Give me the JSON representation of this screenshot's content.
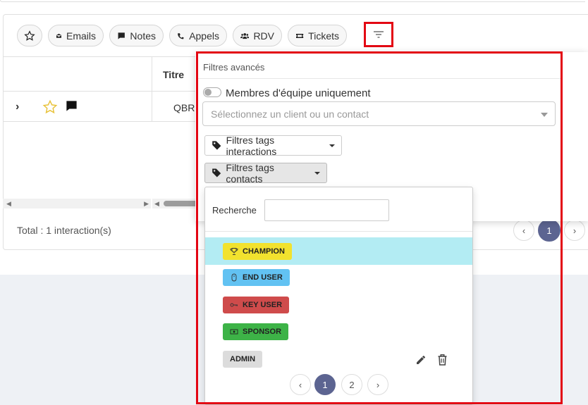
{
  "toolbar": {
    "items": [
      {
        "label": "",
        "icon": "star-icon"
      },
      {
        "label": "Emails",
        "icon": "envelope-icon"
      },
      {
        "label": "Notes",
        "icon": "comment-icon"
      },
      {
        "label": "Appels",
        "icon": "phone-icon"
      },
      {
        "label": "RDV",
        "icon": "users-icon"
      },
      {
        "label": "Tickets",
        "icon": "ticket-icon"
      }
    ],
    "filter_icon": "filter-lines-icon"
  },
  "table": {
    "columns": [
      "",
      "Titre"
    ],
    "rows": [
      {
        "title": "QBR"
      }
    ]
  },
  "footer": {
    "total": "Total : 1 interaction(s)",
    "pages": [
      "‹",
      "1",
      "›"
    ],
    "active_page": "1"
  },
  "advanced_filters": {
    "header": "Filtres avancés",
    "team_toggle_label": "Membres d'équipe uniquement",
    "team_toggle_on": false,
    "client_select_placeholder": "Sélectionnez un client ou un contact",
    "interactions_tags_label": "Filtres tags interactions",
    "contacts_tags_label": "Filtres tags contacts"
  },
  "tag_menu": {
    "search_label": "Recherche",
    "search_value": "",
    "tags": [
      {
        "label": "CHAMPION",
        "color": "#f2e22e",
        "icon": "trophy-icon",
        "highlighted": true
      },
      {
        "label": "END USER",
        "color": "#62c2f2",
        "icon": "mouse-icon",
        "highlighted": false
      },
      {
        "label": "KEY USER",
        "color": "#cf4b4b",
        "icon": "key-icon",
        "highlighted": false
      },
      {
        "label": "SPONSOR",
        "color": "#3db347",
        "icon": "money-icon",
        "highlighted": false
      },
      {
        "label": "ADMIN",
        "color": "#dcdcdc",
        "icon": "",
        "highlighted": false
      }
    ],
    "pages": [
      "‹",
      "1",
      "2",
      "›"
    ],
    "active_page": "1"
  },
  "colors": {
    "accent": "#5c6491",
    "highlight": "#e30613",
    "hover_row": "#b3ecf3"
  }
}
